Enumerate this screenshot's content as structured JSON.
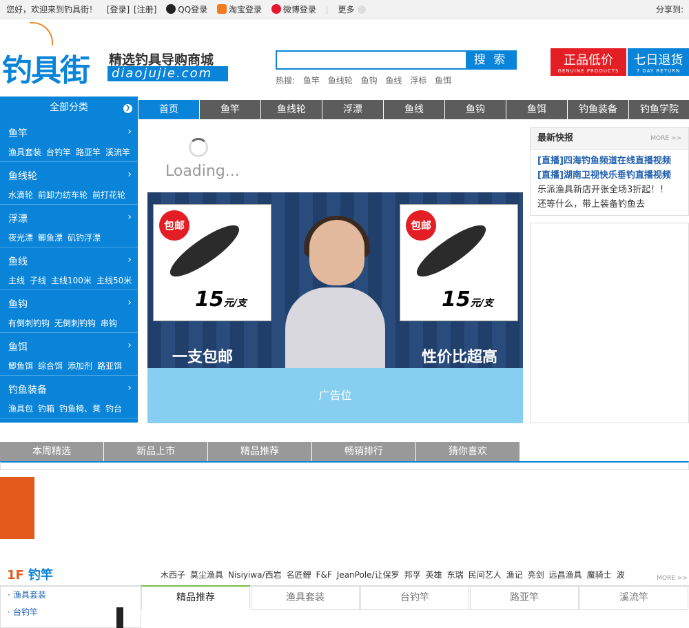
{
  "topbar": {
    "greeting": "您好，欢迎来到钓具街！",
    "login": "[登录]",
    "register": "[注册]",
    "qq_login": "QQ登录",
    "taobao_login": "淘宝登录",
    "weibo_login": "微博登录",
    "more": "更多",
    "share": "分享到:"
  },
  "logo": {
    "name": "钓具街",
    "slogan": "精选钓具导购商城",
    "domain": "diaojujie.com"
  },
  "search": {
    "placeholder": "",
    "button": "搜 索",
    "hot_label": "热搜:",
    "hot_terms": [
      "鱼竿",
      "鱼线轮",
      "鱼钩",
      "鱼线",
      "浮标",
      "鱼饵"
    ]
  },
  "badges": {
    "genuine": "正品低价",
    "genuine_en": "GENUINE PRODUCTS",
    "return": "七日退货",
    "return_en": "7 DAY RETURN"
  },
  "nav": {
    "all_categories": "全部分类",
    "tabs": [
      "首页",
      "鱼竿",
      "鱼线轮",
      "浮漂",
      "鱼线",
      "鱼钩",
      "鱼饵",
      "钓鱼装备",
      "钓鱼学院"
    ]
  },
  "categories": [
    {
      "title": "鱼竿",
      "subs": [
        "渔具套装",
        "台钓竿",
        "路亚竿",
        "溪流竿"
      ]
    },
    {
      "title": "鱼线轮",
      "subs": [
        "水滴轮",
        "前卸力纺车轮",
        "前打花轮"
      ]
    },
    {
      "title": "浮漂",
      "subs": [
        "夜光漂",
        "鲫鱼漂",
        "矶钓浮漂"
      ]
    },
    {
      "title": "鱼线",
      "subs": [
        "主线",
        "子线",
        "主线100米",
        "主线50米"
      ]
    },
    {
      "title": "鱼钩",
      "subs": [
        "有倒刺钓钩",
        "无倒刺钓钩",
        "串钩"
      ]
    },
    {
      "title": "鱼饵",
      "subs": [
        "鲫鱼饵",
        "综合饵",
        "添加剂",
        "路亚饵"
      ]
    },
    {
      "title": "钓鱼装备",
      "subs": [
        "渔具包",
        "钓箱",
        "钓鱼椅、凳",
        "钓台"
      ]
    }
  ],
  "loading": "Loading...",
  "banner": {
    "left_tag": "包邮",
    "right_tag": "包邮",
    "price": "15",
    "unit": "元/支",
    "left_caption": "一支包邮",
    "right_caption": "性价比超高"
  },
  "ad": "广告位",
  "news": {
    "title": "最新快报",
    "more": "MORE >>",
    "items": [
      "[直播]四海钓鱼频道在线直播视频",
      "[直播]湖南卫视快乐垂钓直播视频",
      "乐派渔具新店开张全场3折起！！",
      "还等什么，带上装备钓鱼去"
    ]
  },
  "section_tabs": [
    "本周精选",
    "新品上市",
    "精品推荐",
    "畅销排行",
    "猜你喜欢"
  ],
  "floor": {
    "num": "1F",
    "name": "钓竿",
    "brands": [
      "木西子",
      "莫尘渔具",
      "Nisiyiwa/西岩",
      "名匠鲤",
      "F&F",
      "JeanPole/让保罗",
      "邦孚",
      "英雄",
      "东瑞",
      "民间艺人",
      "渔记",
      "亮剑",
      "远昌渔具",
      "魔骑士",
      "波"
    ],
    "more": "MORE >>",
    "left_links": [
      "渔具套装",
      "台钓竿"
    ],
    "tabs": [
      "精品推荐",
      "渔具套装",
      "台钓竿",
      "路亚竿",
      "溪流竿"
    ]
  },
  "colors": {
    "brand_blue": "#0a84d8",
    "nav_gray": "#5c5c5c",
    "orange": "#e25b1d",
    "red": "#e31e24"
  }
}
